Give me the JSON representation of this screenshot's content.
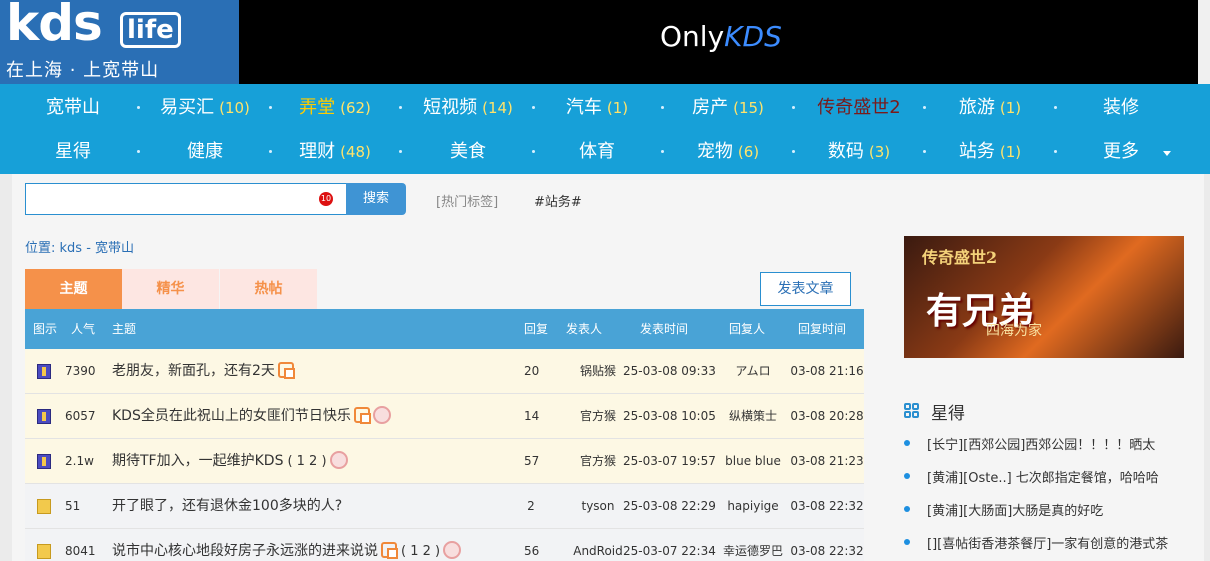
{
  "header": {
    "logo_main": "kds",
    "logo_life": "life",
    "slogan": "在上海 · 上宽带山",
    "banner_text": "Only",
    "banner_brand": "KDS"
  },
  "nav": {
    "row1": [
      {
        "label": "宽带山",
        "count": ""
      },
      {
        "label": "易买汇",
        "count": "(10)"
      },
      {
        "label": "弄堂",
        "count": "(62)"
      },
      {
        "label": "短视频",
        "count": "(14)"
      },
      {
        "label": "汽车",
        "count": "(1)"
      },
      {
        "label": "房产",
        "count": "(15)"
      },
      {
        "label": "传奇盛世2",
        "count": ""
      },
      {
        "label": "旅游",
        "count": "(1)"
      },
      {
        "label": "装修",
        "count": ""
      }
    ],
    "row2": [
      {
        "label": "星得",
        "count": ""
      },
      {
        "label": "健康",
        "count": ""
      },
      {
        "label": "理财",
        "count": "(48)"
      },
      {
        "label": "美食",
        "count": ""
      },
      {
        "label": "体育",
        "count": ""
      },
      {
        "label": "宠物",
        "count": "(6)"
      },
      {
        "label": "数码",
        "count": "(3)"
      },
      {
        "label": "站务",
        "count": "(1)"
      },
      {
        "label": "更多",
        "count": ""
      }
    ]
  },
  "search": {
    "value": "",
    "badge": "10",
    "button_label": "搜索",
    "hot_tags_label": "[热门标签]",
    "tag": "#站务#"
  },
  "breadcrumb": "位置:   kds - 宽带山",
  "tabs": {
    "main": "主题",
    "digest": "精华",
    "hot": "热帖",
    "post_button": "发表文章"
  },
  "table": {
    "headers": {
      "icon": "图示",
      "popularity": "人气",
      "title": "主题",
      "replies": "回复",
      "author": "发表人",
      "post_time": "发表时间",
      "replier": "回复人",
      "reply_time": "回复时间"
    },
    "rows": [
      {
        "pop": "7390",
        "title": "老朋友，新面孔，还有2天",
        "pages": "",
        "replies": "20",
        "author": "锅贴猴",
        "time": "25-03-08 09:33",
        "replier": "アムロ",
        "rtime": "03-08 21:16"
      },
      {
        "pop": "6057",
        "title": "KDS全员在此祝山上的女匪们节日快乐",
        "pages": "",
        "replies": "14",
        "author": "官方猴",
        "time": "25-03-08 10:05",
        "replier": "纵横策士",
        "rtime": "03-08 20:28"
      },
      {
        "pop": "2.1w",
        "title": "期待TF加入，一起维护KDS",
        "pages": "( 1  2 )",
        "replies": "57",
        "author": "官方猴",
        "time": "25-03-07 19:57",
        "replier": "blue blue",
        "rtime": "03-08 21:23"
      },
      {
        "pop": "51",
        "title": "开了眼了，还有退休金100多块的人?",
        "pages": "",
        "replies": "2",
        "author": "tyson",
        "time": "25-03-08 22:29",
        "replier": "hapiyige",
        "rtime": "03-08 22:32"
      },
      {
        "pop": "8041",
        "title": "说市中心核心地段好房子永远涨的进来说说",
        "pages": "( 1  2 )",
        "replies": "56",
        "author": "AndRoid",
        "time": "25-03-07 22:34",
        "replier": "幸运德罗巴",
        "rtime": "03-08 22:32"
      }
    ]
  },
  "sidebar": {
    "ad": {
      "line1": "传奇盛世2",
      "line2": "有兄弟",
      "line3": "四海为家"
    },
    "section_title": "星得",
    "items": [
      "[长宁][西郊公园]西郊公园！！！！晒太",
      "[黄浦][Oste..] 七次郎指定餐馆，哈哈哈",
      "[黄浦][大肠面]大肠是真的好吃",
      "[][喜帖街香港茶餐厅]一家有创意的港式茶"
    ]
  },
  "colors": {
    "nav_bg": "#17a0d8",
    "nav_count": "#ffe36b",
    "active_tab": "#f5914a",
    "table_header": "#49a3d6",
    "highlight_row": "#fdf8e4"
  }
}
